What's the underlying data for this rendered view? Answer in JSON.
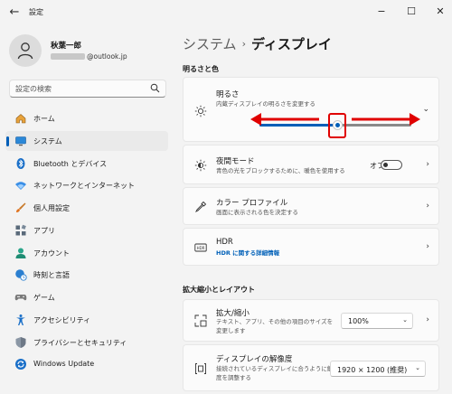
{
  "titlebar": {
    "app_title": "設定",
    "back_glyph": "←",
    "minimize_glyph": "−",
    "maximize_glyph": "☐",
    "close_glyph": "✕"
  },
  "profile": {
    "name": "秋葉一郎",
    "email_domain": "@outlook.jp"
  },
  "search": {
    "placeholder": "設定の検索"
  },
  "nav": {
    "items": [
      {
        "label": "ホーム",
        "icon": "home-icon"
      },
      {
        "label": "システム",
        "icon": "monitor-icon",
        "active": true
      },
      {
        "label": "Bluetooth とデバイス",
        "icon": "bluetooth-icon"
      },
      {
        "label": "ネットワークとインターネット",
        "icon": "wifi-icon"
      },
      {
        "label": "個人用設定",
        "icon": "brush-icon"
      },
      {
        "label": "アプリ",
        "icon": "apps-icon"
      },
      {
        "label": "アカウント",
        "icon": "person-icon"
      },
      {
        "label": "時刻と言語",
        "icon": "globe-clock-icon"
      },
      {
        "label": "ゲーム",
        "icon": "gamepad-icon"
      },
      {
        "label": "アクセシビリティ",
        "icon": "accessibility-icon"
      },
      {
        "label": "プライバシーとセキュリティ",
        "icon": "shield-icon"
      },
      {
        "label": "Windows Update",
        "icon": "update-icon"
      }
    ]
  },
  "breadcrumb": {
    "parent": "システム",
    "separator": "›",
    "current": "ディスプレイ"
  },
  "sections": {
    "brightness_color": "明るさと色",
    "scale_layout": "拡大縮小とレイアウト"
  },
  "cards": {
    "brightness": {
      "title": "明るさ",
      "desc": "内蔵ディスプレイの明るさを変更する",
      "icon": "sun-icon",
      "chevron": "⌄",
      "level": 0.51
    },
    "night_light": {
      "title": "夜間モード",
      "desc": "青色の光をブロックするために、暖色を使用する",
      "icon": "sun-moon-icon",
      "state_text": "オフ",
      "chevron": "›"
    },
    "color_profile": {
      "title": "カラー プロファイル",
      "desc": "画面に表示される色を決定する",
      "icon": "eyedropper-icon",
      "chevron": "›"
    },
    "hdr": {
      "title": "HDR",
      "desc": "HDR に関する詳細情報",
      "icon": "hdr-icon",
      "chevron": "›"
    },
    "scale": {
      "title": "拡大/縮小",
      "desc_line1": "テキスト、アプリ、その他の項目のサイズを",
      "desc_line2": "変更します",
      "icon": "scale-icon",
      "value": "100%",
      "chevron": "›"
    },
    "resolution": {
      "title": "ディスプレイの解像度",
      "desc_line1": "接続されているディスプレイに合うように解像",
      "desc_line2": "度を調整する",
      "icon": "resolution-icon",
      "value": "1920 × 1200 (推奨)"
    }
  },
  "colors": {
    "accent": "#005fb8",
    "annotation": "#e00000"
  }
}
